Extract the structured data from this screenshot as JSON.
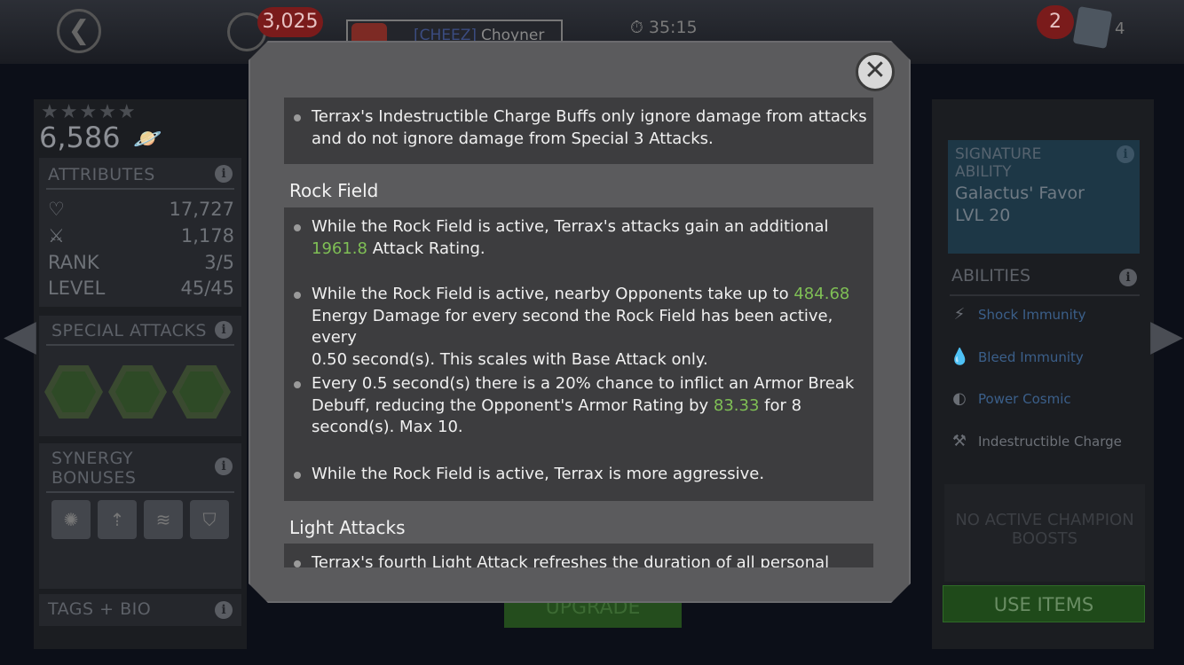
{
  "topbar": {
    "units": "3,025",
    "alert_count": "2",
    "player_tag": "[CHEEZ]",
    "player_name": "Choyner",
    "timer": "35:15",
    "cards_count": "4"
  },
  "champion": {
    "stars": "★★★★★",
    "rating": "6,586"
  },
  "attributes": {
    "title": "ATTRIBUTES",
    "health": "17,727",
    "attack": "1,178",
    "rank_label": "RANK",
    "rank": "3/5",
    "level_label": "LEVEL",
    "level": "45/45"
  },
  "special_attacks": {
    "title": "SPECIAL ATTACKS"
  },
  "synergy": {
    "title_line1": "SYNERGY",
    "title_line2": "BONUSES"
  },
  "tags": {
    "title": "TAGS + BIO"
  },
  "signature": {
    "title_line1": "SIGNATURE",
    "title_line2": "ABILITY",
    "name": "Galactus' Favor",
    "level": "LVL 20"
  },
  "abilities": {
    "title": "ABILITIES",
    "items": [
      {
        "label": "Shock Immunity",
        "color": "#3b5f8a",
        "icon": "shock-icon"
      },
      {
        "label": "Bleed Immunity",
        "color": "#3b5f8a",
        "icon": "blood-drop-icon"
      },
      {
        "label": "Power Cosmic",
        "color": "#3b5f8a",
        "icon": "cosmic-icon"
      },
      {
        "label": "Indestructible Charge",
        "color": "#6d7178",
        "icon": "hammer-icon"
      }
    ]
  },
  "boosts": {
    "line1": "NO ACTIVE CHAMPION",
    "line2": "BOOSTS"
  },
  "use_items": "USE ITEMS",
  "upgrade": "UPGRADE",
  "modal": {
    "close_glyph": "✕",
    "intro": {
      "line1": "Terrax's Indestructible Charge Buffs only ignore damage from attacks",
      "line2": "and do not ignore damage from Special 3 Attacks."
    },
    "rock_field": {
      "heading": "Rock Field",
      "b1_pre": "While the Rock Field is active, Terrax's attacks gain an additional",
      "b1_val": "1961.8",
      "b1_post": " Attack Rating.",
      "b2_pre": "While the Rock Field is active, nearby Opponents take up to ",
      "b2_val": "484.68",
      "b2_post_l1": "Energy Damage for every second the Rock Field has been active, every",
      "b2_post_l2": "0.50 second(s). This scales with Base Attack only.",
      "b3_l1": "Every 0.5 second(s) there is a 20% chance to inflict an Armor Break",
      "b3_l2_pre": "Debuff, reducing the Opponent's Armor Rating by ",
      "b3_val": "83.33",
      "b3_l2_post": " for 8",
      "b3_l3": "second(s). Max 10.",
      "b4": "While the Rock Field is active, Terrax is more aggressive."
    },
    "light_attacks": {
      "heading": "Light Attacks",
      "b1": "Terrax's fourth Light Attack refreshes the duration of all personal"
    }
  }
}
